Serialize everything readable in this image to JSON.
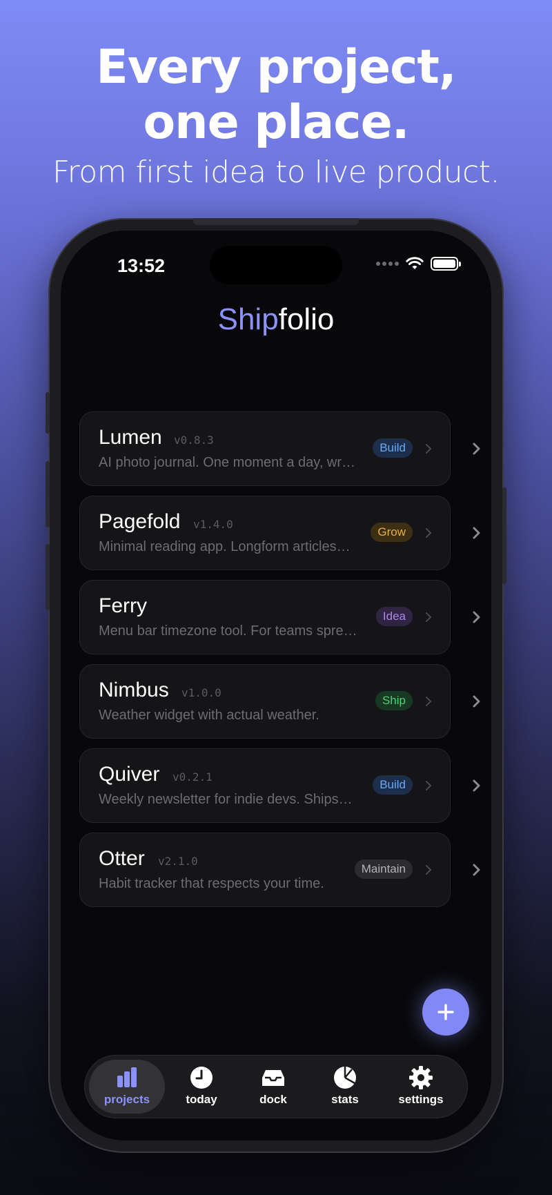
{
  "marketing": {
    "headline_line1": "Every project,",
    "headline_line2": "one place.",
    "subheadline": "From first idea to live product."
  },
  "status_bar": {
    "time": "13:52",
    "icons": [
      "cellular-signal-icon",
      "wifi-icon",
      "battery-icon"
    ]
  },
  "app": {
    "title_accent": "Ship",
    "title_rest": "folio",
    "accent_color": "#8c92fb"
  },
  "projects": [
    {
      "name": "Lumen",
      "version": "v0.8.3",
      "description": "AI photo journal. One moment a day, wr…",
      "status": "Build"
    },
    {
      "name": "Pagefold",
      "version": "v1.4.0",
      "description": "Minimal reading app. Longform articles…",
      "status": "Grow"
    },
    {
      "name": "Ferry",
      "version": "",
      "description": "Menu bar timezone tool. For teams spre…",
      "status": "Idea"
    },
    {
      "name": "Nimbus",
      "version": "v1.0.0",
      "description": "Weather widget with actual weather.",
      "status": "Ship"
    },
    {
      "name": "Quiver",
      "version": "v0.2.1",
      "description": "Weekly newsletter for indie devs. Ships…",
      "status": "Build"
    },
    {
      "name": "Otter",
      "version": "v2.1.0",
      "description": "Habit tracker that respects your time.",
      "status": "Maintain"
    }
  ],
  "status_colors": {
    "Build": "#6aaaf2",
    "Grow": "#e9b045",
    "Idea": "#ad86ec",
    "Ship": "#4ed178",
    "Maintain": "#b4b4ba"
  },
  "fab": {
    "icon": "plus-icon",
    "color": "#8089f6"
  },
  "tabbar": {
    "active": "projects",
    "tabs": [
      {
        "id": "projects",
        "label": "projects",
        "icon": "bar-chart-icon"
      },
      {
        "id": "today",
        "label": "today",
        "icon": "clock-icon"
      },
      {
        "id": "dock",
        "label": "dock",
        "icon": "inbox-tray-icon"
      },
      {
        "id": "stats",
        "label": "stats",
        "icon": "pie-chart-icon"
      },
      {
        "id": "settings",
        "label": "settings",
        "icon": "gear-icon"
      }
    ]
  }
}
